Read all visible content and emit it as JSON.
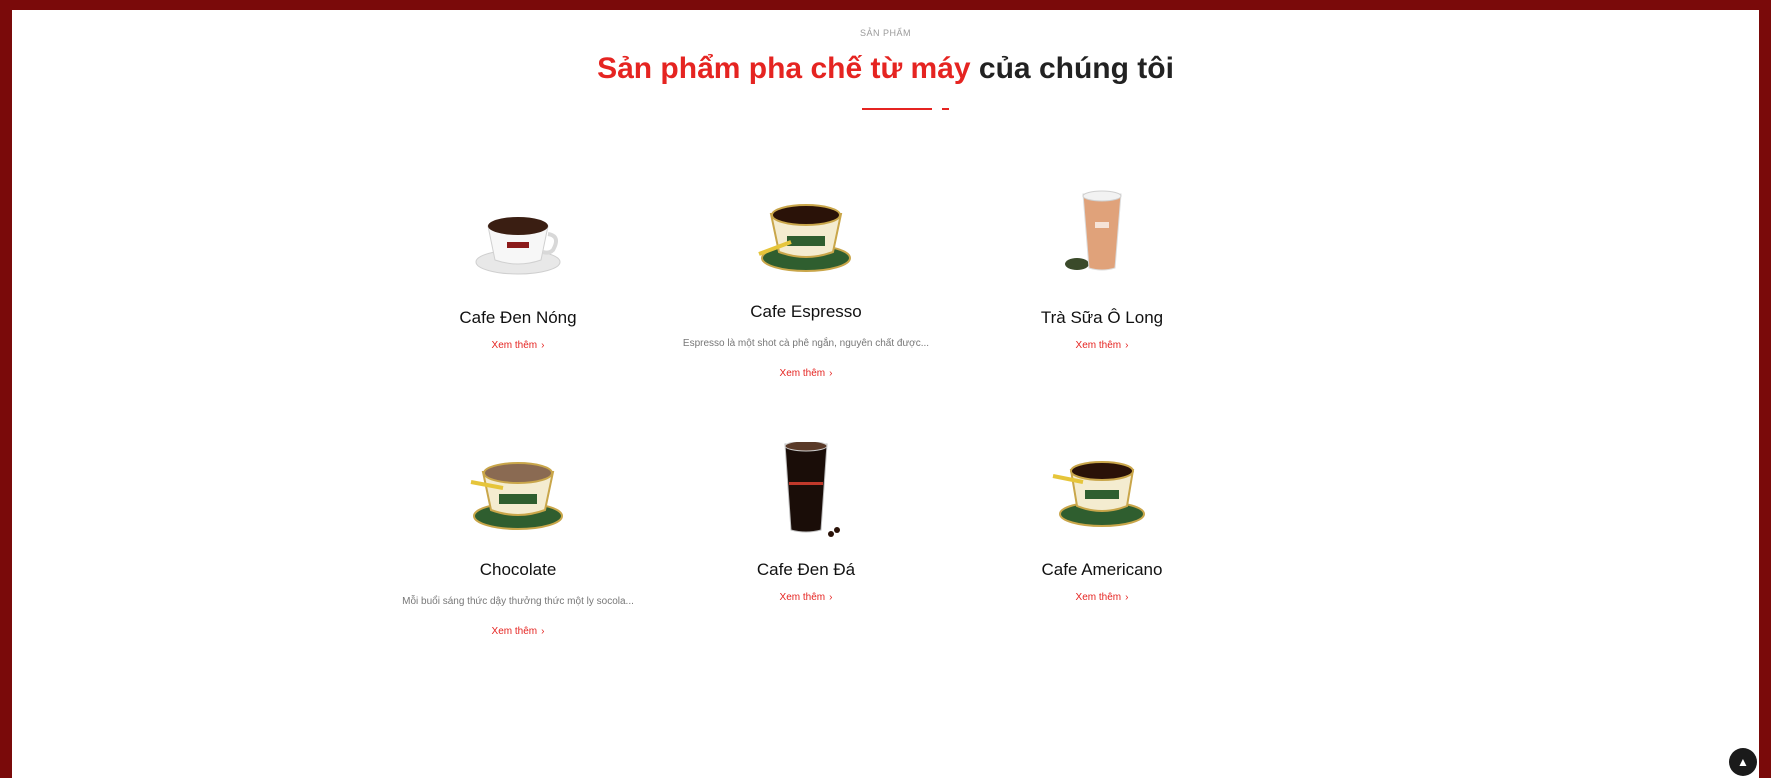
{
  "section": {
    "eyebrow": "SẢN PHẨM",
    "title_accent": "Sản phẩm pha chế từ máy",
    "title_rest": " của chúng tôi"
  },
  "products": [
    {
      "name": "Cafe Đen Nóng",
      "desc": "",
      "more": "Xem thêm",
      "icon": "hot-black-coffee-cup-icon"
    },
    {
      "name": "Cafe Espresso",
      "desc": "Espresso là một shot cà phê ngắn, nguyên chất được...",
      "more": "Xem thêm",
      "icon": "espresso-cup-icon"
    },
    {
      "name": "Trà Sữa Ô Long",
      "desc": "",
      "more": "Xem thêm",
      "icon": "oolong-milk-tea-cup-icon"
    },
    {
      "name": "Chocolate",
      "desc": "Mỗi buổi sáng thức dậy thưởng thức một ly socola...",
      "more": "Xem thêm",
      "icon": "chocolate-cup-icon"
    },
    {
      "name": "Cafe Đen Đá",
      "desc": "",
      "more": "Xem thêm",
      "icon": "iced-black-coffee-glass-icon"
    },
    {
      "name": "Cafe Americano",
      "desc": "",
      "more": "Xem thêm",
      "icon": "americano-cup-icon"
    }
  ],
  "scroll_top_icon": "chevron-up-icon",
  "colors": {
    "accent": "#e52421",
    "frame": "#7a0a0a"
  }
}
